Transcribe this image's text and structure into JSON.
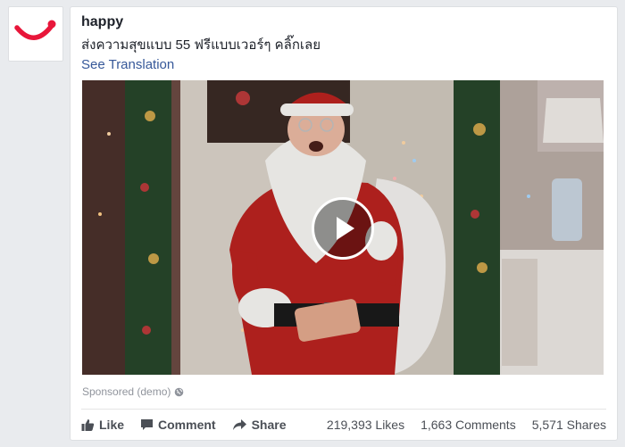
{
  "post": {
    "page_name": "happy",
    "text": "ส่งความสุขแบบ 55 ฟรีแบบเวอร์ๆ คลิ๊กเลย",
    "see_translation": "See Translation",
    "sponsored": "Sponsored (demo)"
  },
  "video": {
    "play_icon": "play-icon"
  },
  "actions": {
    "like": "Like",
    "comment": "Comment",
    "share": "Share"
  },
  "stats": {
    "likes": "219,393 Likes",
    "comments": "1,663 Comments",
    "shares": "5,571 Shares"
  },
  "colors": {
    "brand": "#e8163a",
    "link": "#365899",
    "muted": "#90949c"
  }
}
